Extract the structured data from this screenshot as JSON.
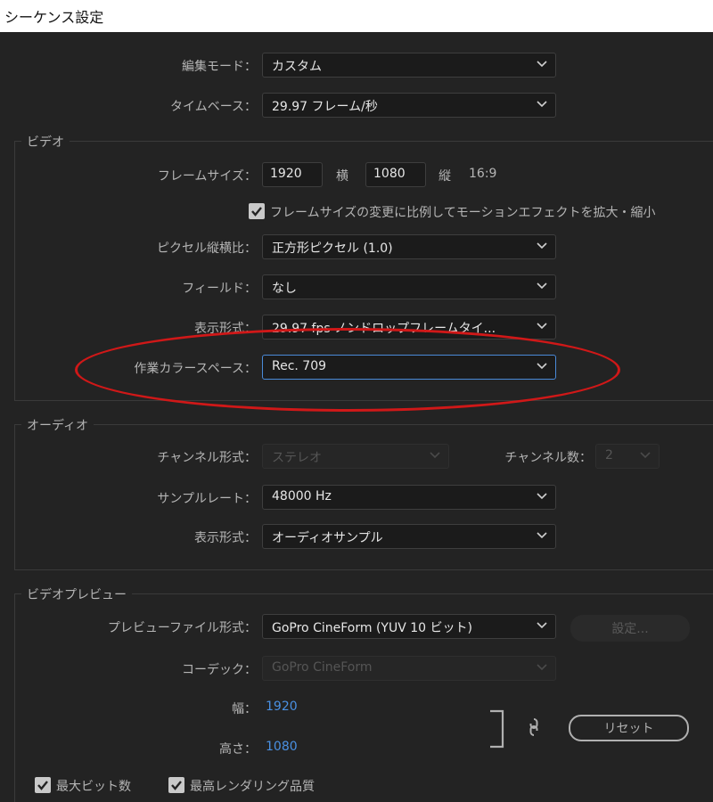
{
  "window": {
    "title": "シーケンス設定"
  },
  "general": {
    "edit_mode_label": "編集モード：",
    "edit_mode_value": "カスタム",
    "timebase_label": "タイムベース：",
    "timebase_value": "29.97  フレーム/秒"
  },
  "video": {
    "group_title": "ビデオ",
    "frame_size_label": "フレームサイズ：",
    "frame_width": "1920",
    "horizontal_label": "横",
    "frame_height": "1080",
    "vertical_label": "縦",
    "aspect": "16:9",
    "scale_checkbox_label": "フレームサイズの変更に比例してモーションエフェクトを拡大・縮小",
    "scale_checkbox_checked": true,
    "pixel_aspect_label": "ピクセル縦横比：",
    "pixel_aspect_value": "正方形ピクセル (1.0)",
    "fields_label": "フィールド：",
    "fields_value": "なし",
    "display_format_label": "表示形式：",
    "display_format_value": "29.97 fps ノンドロップフレームタイ...",
    "color_space_label": "作業カラースペース：",
    "color_space_value": "Rec. 709"
  },
  "audio": {
    "group_title": "オーディオ",
    "channel_format_label": "チャンネル形式：",
    "channel_format_value": "ステレオ",
    "channel_count_label": "チャンネル数：",
    "channel_count_value": "2",
    "sample_rate_label": "サンプルレート：",
    "sample_rate_value": "48000 Hz",
    "display_format_label": "表示形式：",
    "display_format_value": "オーディオサンプル"
  },
  "preview": {
    "group_title": "ビデオプレビュー",
    "file_format_label": "プレビューファイル形式：",
    "file_format_value": "GoPro CineForm (YUV 10 ビット)",
    "settings_button": "設定...",
    "codec_label": "コーデック：",
    "codec_value": "GoPro CineForm",
    "width_label": "幅：",
    "width_value": "1920",
    "height_label": "高さ：",
    "height_value": "1080",
    "reset_button": "リセット"
  },
  "footer": {
    "max_bit_depth_label": "最大ビット数",
    "max_bit_depth_checked": true,
    "max_render_quality_label": "最高レンダリング品質",
    "max_render_quality_checked": true
  },
  "colors": {
    "background": "#232323",
    "accent_blue": "#4a90e2",
    "highlight_red": "#d01818"
  }
}
